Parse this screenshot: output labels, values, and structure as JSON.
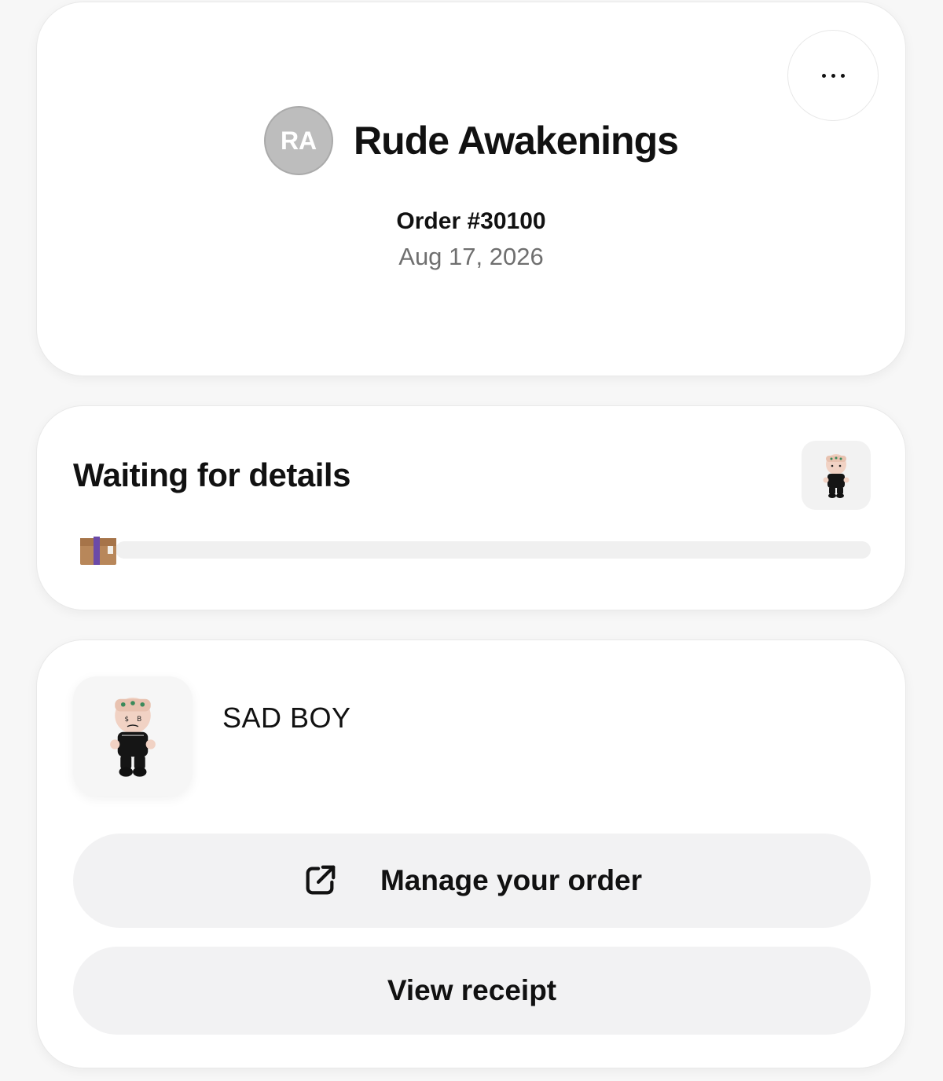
{
  "header": {
    "store_initials": "RA",
    "store_name": "Rude Awakenings",
    "order_number": "Order #30100",
    "order_date": "Aug 17, 2026",
    "more_icon": "ellipsis-icon"
  },
  "status": {
    "title": "Waiting for details",
    "progress": 0,
    "progress_icon": "package-box-icon"
  },
  "product": {
    "name": "SAD BOY"
  },
  "actions": {
    "manage_label": "Manage your order",
    "manage_icon": "external-link-icon",
    "receipt_label": "View receipt"
  },
  "colors": {
    "background": "#f7f7f7",
    "card": "#ffffff",
    "button": "#f2f2f3",
    "avatar": "#bdbdbd",
    "muted_text": "#6f6f6f"
  }
}
